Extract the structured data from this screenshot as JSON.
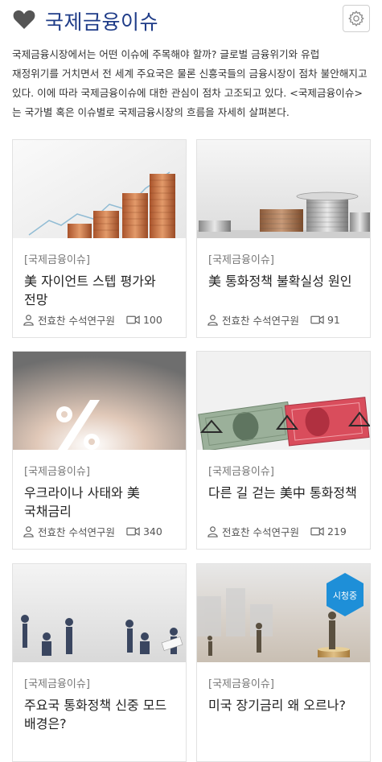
{
  "header": {
    "title": "국제금융이슈"
  },
  "description": "국제금융시장에서는 어떤 이슈에 주목해야 할까? 글로벌 금융위기와 유럽 재정위기를 거치면서 전 세계 주요국은 물론 신흥국들의 금융시장이 점차 불안해지고 있다. 이에 따라 국제금융이슈에 대한 관심이 점차 고조되고 있다. <국제금융이슈>는 국가별 혹은 이슈별로 국제금융시장의 흐름을 자세히 살펴본다.",
  "cards": [
    {
      "category": "[국제금융이슈]",
      "title": "美 자이언트 스텝 평가와 전망",
      "author": "전효찬 수석연구원",
      "views": "100"
    },
    {
      "category": "[국제금융이슈]",
      "title": "美 통화정책 불확실성 원인",
      "author": "전효찬 수석연구원",
      "views": "91"
    },
    {
      "category": "[국제금융이슈]",
      "title": "우크라이나 사태와 美 국채금리",
      "author": "전효찬 수석연구원",
      "views": "340"
    },
    {
      "category": "[국제금융이슈]",
      "title": "다른 길 걷는 美中 통화정책",
      "author": "전효찬 수석연구원",
      "views": "219"
    },
    {
      "category": "[국제금융이슈]",
      "title": "주요국 통화정책 신중 모드 배경은?",
      "author": "",
      "views": ""
    },
    {
      "category": "[국제금융이슈]",
      "title": "미국 장기금리 왜 오르나?",
      "author": "",
      "views": "",
      "badge": "시청중"
    }
  ],
  "colors": {
    "title": "#1f3c88",
    "badge": "#1e8fd8"
  },
  "icons": {
    "heart": "heart-icon",
    "settings": "gear-icon",
    "author": "user-icon",
    "views": "video-icon"
  }
}
